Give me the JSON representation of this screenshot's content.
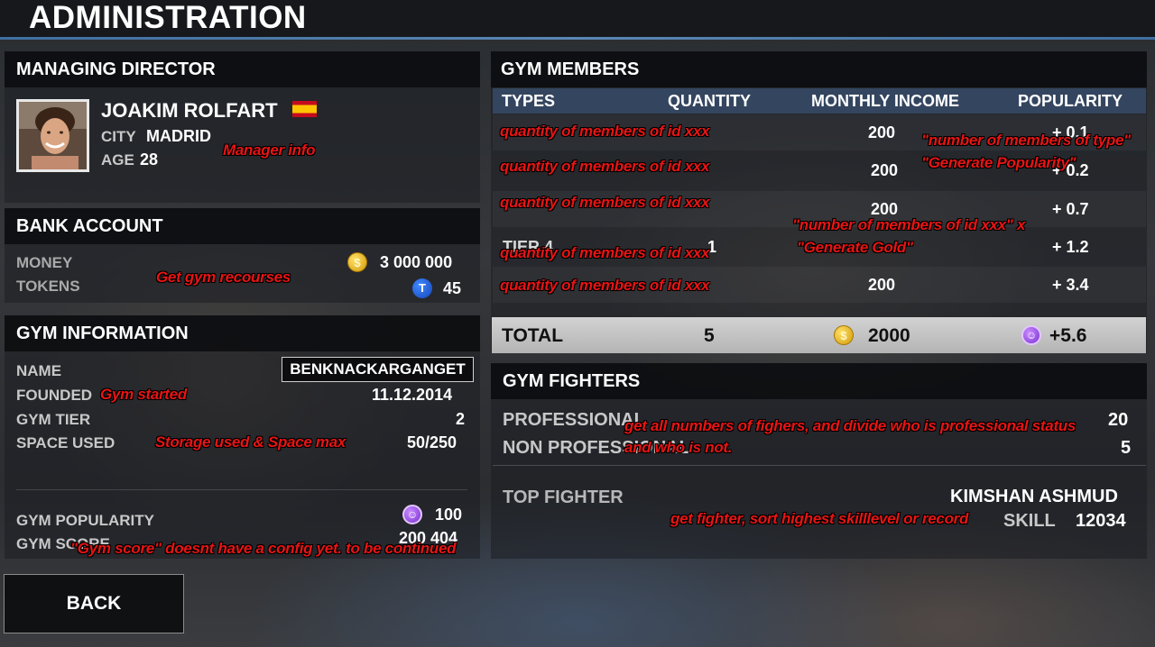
{
  "header": {
    "title": "ADMINISTRATION"
  },
  "manager": {
    "section_title": "MANAGING DIRECTOR",
    "name": "JOAKIM ROLFART",
    "city_label": "CITY",
    "city": "MADRID",
    "age_label": "AGE",
    "age": "28",
    "flag": "spain-flag",
    "annotation": "Manager info"
  },
  "bank": {
    "section_title": "BANK ACCOUNT",
    "money_label": "MONEY",
    "money": "3 000 000",
    "tokens_label": "TOKENS",
    "tokens": "45",
    "coin_icon": "$",
    "token_icon": "T",
    "annotation": "Get gym recourses"
  },
  "gym_info": {
    "section_title": "GYM INFORMATION",
    "name_label": "NAME",
    "name": "BENKNACKARGANGET",
    "founded_label": "FOUNDED",
    "founded": "11.12.2014",
    "founded_annotation": "Gym started",
    "tier_label": "GYM TIER",
    "tier": "2",
    "space_label": "SPACE USED",
    "space": "50/250",
    "space_annotation": "Storage used  & Space max",
    "popularity_label": "GYM POPULARITY",
    "popularity": "100",
    "score_label": "GYM SCORE",
    "score": "200 404",
    "score_annotation": "\"Gym score\" doesnt have a config yet. to be continued"
  },
  "members": {
    "section_title": "GYM MEMBERS",
    "columns": [
      "TYPES",
      "QUANTITY",
      "MONTHLY INCOME",
      "POPULARITY"
    ],
    "rows": [
      {
        "type": "",
        "quantity": "",
        "income": "200",
        "popularity": "+ 0.1",
        "annotation": "quantity of members of id xxx"
      },
      {
        "type": "",
        "quantity": "",
        "income": "200",
        "popularity": "+ 0.2",
        "annotation": "quantity of members of id xxx"
      },
      {
        "type": "",
        "quantity": "",
        "income": "200",
        "popularity": "+ 0.7",
        "annotation": "quantity of members of id xxx"
      },
      {
        "type": "TIER 4",
        "quantity": "1",
        "income": "",
        "popularity": "+ 1.2",
        "annotation": "quantity of members of id xxx"
      },
      {
        "type": "",
        "quantity": "",
        "income": "200",
        "popularity": "+ 3.4",
        "annotation": "quantity of members of id xxx"
      }
    ],
    "annotation_popularity_1": "\"number of members of type\"",
    "annotation_popularity_2": "\"Generate Popularity\"",
    "annotation_income_1": "\"number of members of id xxx\" x",
    "annotation_income_2": "\"Generate Gold\"",
    "total_label": "TOTAL",
    "total_quantity": "5",
    "total_income": "2000",
    "total_popularity": "+5.6"
  },
  "fighters": {
    "section_title": "GYM FIGHTERS",
    "professional_label": "PROFESSIONAL",
    "professional": "20",
    "non_professional_label": "NON PROFESSIONAL",
    "non_professional": "5",
    "fighters_annotation_1": "get all numbers of fighers, and divide who is professional status",
    "fighters_annotation_2": "and who is not.",
    "top_fighter_label": "TOP FIGHTER",
    "top_fighter_name": "KIMSHAN ASHMUD",
    "skill_label": "SKILL",
    "skill": "12034",
    "top_fighter_annotation": "get fighter, sort highest skilllevel or record"
  },
  "footer": {
    "back_label": "BACK"
  },
  "colors": {
    "accent": "#5b86b3",
    "annotation": "#e81414",
    "gold": "#d39a0a",
    "token": "#1645b8",
    "popularity": "#7a2fd0"
  }
}
